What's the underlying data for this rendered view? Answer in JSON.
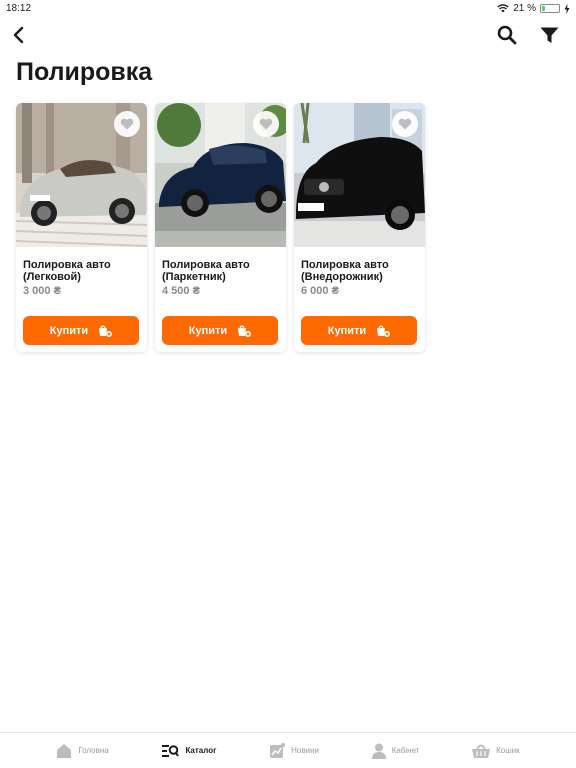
{
  "status": {
    "time": "18:12",
    "battery": "21 %",
    "battery_level": 0.21
  },
  "page": {
    "title": "Полировка"
  },
  "products": [
    {
      "name": "Полировка авто (Легковой)",
      "price": "3 000 ₴",
      "buy_label": "Купити",
      "car_color": "#c9c9c6"
    },
    {
      "name": "Полировка авто (Паркетник)",
      "price": "4 500 ₴",
      "buy_label": "Купити",
      "car_color": "#12233f"
    },
    {
      "name": "Полировка авто (Внедорожник)",
      "price": "6 000 ₴",
      "buy_label": "Купити",
      "car_color": "#0f0f10"
    }
  ],
  "tabbar": {
    "items": [
      {
        "label": "Головна",
        "icon": "home-icon"
      },
      {
        "label": "Каталог",
        "icon": "catalog-icon"
      },
      {
        "label": "Новини",
        "icon": "news-icon"
      },
      {
        "label": "Кабінет",
        "icon": "user-icon"
      },
      {
        "label": "Кошик",
        "icon": "basket-icon"
      }
    ]
  },
  "colors": {
    "accent": "#ff6a00",
    "muted": "#9a9a9a"
  }
}
